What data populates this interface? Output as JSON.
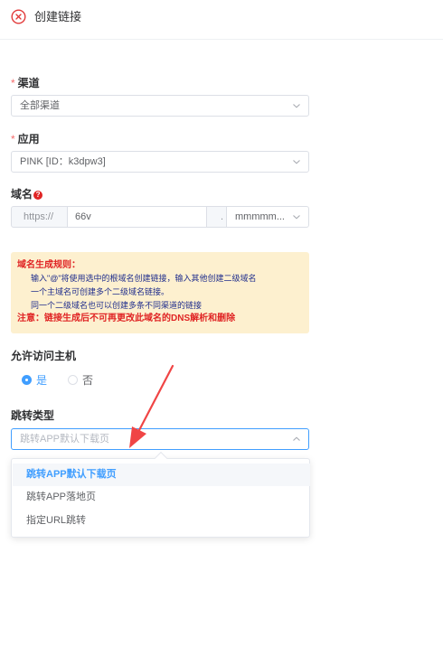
{
  "header": {
    "title": "创建链接"
  },
  "channel": {
    "label": "渠道",
    "required": "*",
    "value": "全部渠道"
  },
  "app": {
    "label": "应用",
    "required": "*",
    "value": "PINK [ID：k3dpw3]"
  },
  "domain": {
    "label": "域名",
    "help": "?",
    "prefix": "https://",
    "subdomain": "66v",
    "dot": ".",
    "root": "mmmmm..."
  },
  "rules": {
    "title": "域名生成规则：",
    "lines": [
      "输入\"@\"将使用选中的根域名创建链接，输入其他创建二级域名",
      "一个主域名可创建多个二级域名链接。",
      "同一个二级域名也可以创建多条不同渠道的链接"
    ],
    "note": "注意：链接生成后不可再更改此域名的DNS解析和删除"
  },
  "access": {
    "label": "允许访问主机",
    "options": [
      "是",
      "否"
    ],
    "selected": "是"
  },
  "redirect": {
    "label": "跳转类型",
    "placeholder": "跳转APP默认下载页",
    "options": [
      "跳转APP默认下载页",
      "跳转APP落地页",
      "指定URL跳转"
    ]
  },
  "colors": {
    "primary": "#409eff",
    "danger": "#e02424",
    "notice_bg": "#fdf0cf",
    "arrow": "#f04545"
  }
}
